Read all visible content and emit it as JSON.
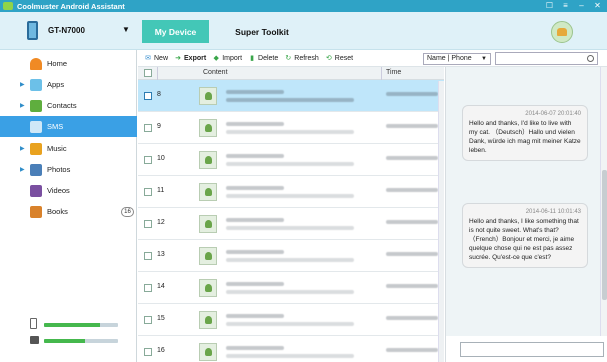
{
  "app": {
    "title": "Coolmuster Android Assistant"
  },
  "header": {
    "device_name": "GT-N7000",
    "tabs": [
      {
        "label": "My Device",
        "active": true
      },
      {
        "label": "Super Toolkit",
        "active": false
      }
    ]
  },
  "sidebar": {
    "items": [
      {
        "label": "Home",
        "icon": "home-icon",
        "expandable": false
      },
      {
        "label": "Apps",
        "icon": "apps-icon",
        "expandable": true
      },
      {
        "label": "Contacts",
        "icon": "contacts-icon",
        "expandable": true
      },
      {
        "label": "SMS",
        "icon": "sms-icon",
        "expandable": false,
        "active": true
      },
      {
        "label": "Music",
        "icon": "music-icon",
        "expandable": true
      },
      {
        "label": "Photos",
        "icon": "photos-icon",
        "expandable": true
      },
      {
        "label": "Videos",
        "icon": "videos-icon",
        "expandable": false
      },
      {
        "label": "Books",
        "icon": "books-icon",
        "expandable": false,
        "badge": "16"
      }
    ],
    "storage": [
      {
        "name": "phone-storage",
        "used_fraction": 0.75
      },
      {
        "name": "sd-card-storage",
        "used_fraction": 0.55
      }
    ]
  },
  "toolbar": {
    "new_label": "New",
    "export_label": "Export",
    "import_label": "Import",
    "delete_label": "Delete",
    "refresh_label": "Refresh",
    "reset_label": "Reset",
    "filter_value": "Name | Phone",
    "search_value": ""
  },
  "list": {
    "columns": {
      "content": "Content",
      "time": "Time"
    },
    "rows": [
      {
        "num": "8",
        "selected": true
      },
      {
        "num": "9",
        "selected": false
      },
      {
        "num": "10",
        "selected": false
      },
      {
        "num": "11",
        "selected": false
      },
      {
        "num": "12",
        "selected": false
      },
      {
        "num": "13",
        "selected": false
      },
      {
        "num": "14",
        "selected": false
      },
      {
        "num": "15",
        "selected": false
      },
      {
        "num": "16",
        "selected": false
      }
    ]
  },
  "conversation": {
    "messages": [
      {
        "time": "2014-06-07 20:01:40",
        "text": "Hello and thanks, I'd like to live with my cat. （Deutsch）Hallo und vielen Dank, würde ich mag mit meiner Katze leben."
      },
      {
        "time": "2014-06-11 10:01:43",
        "text": "Hello and thanks, I like something that is not quite sweet. What's that?（French）Bonjour et merci, je aime quelque chose qui ne est pas assez sucrée. Qu'est-ce que c'est?"
      }
    ],
    "reply_value": ""
  },
  "colors": {
    "accent": "#43c7b7",
    "titlebar": "#2fa3c6",
    "selection": "#bfe6fa",
    "sidebar_active": "#3aa0e5"
  }
}
